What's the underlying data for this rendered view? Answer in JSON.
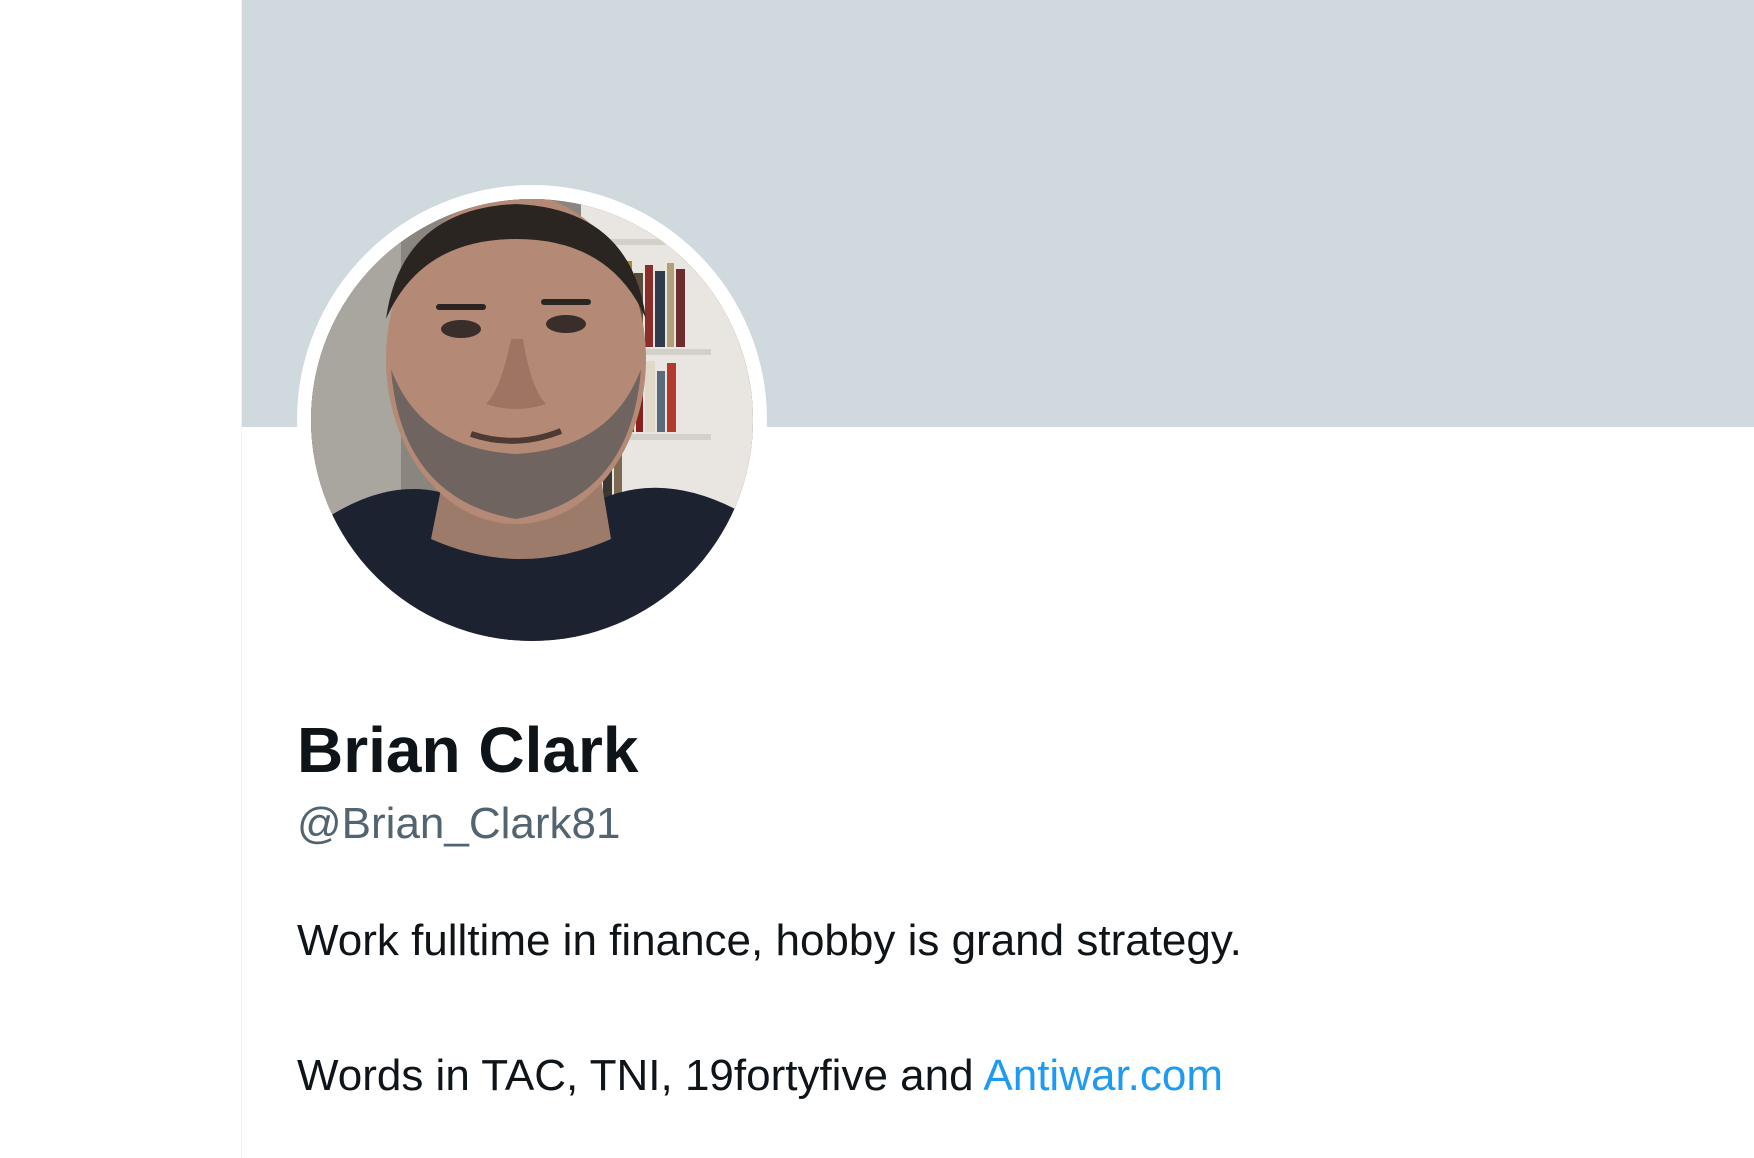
{
  "profile": {
    "display_name": "Brian Clark",
    "handle": "@Brian_Clark81",
    "bio": {
      "line1": "Work fulltime in finance, hobby is grand strategy.",
      "line2_text": "Words in TAC, TNI, 19fortyfive and ",
      "line2_link": "Antiwar.com"
    },
    "avatar_icon": "profile-photo"
  },
  "colors": {
    "banner": "#cfd9de",
    "name": "#0f1419",
    "handle": "#536471",
    "link": "#1d9bf0"
  }
}
